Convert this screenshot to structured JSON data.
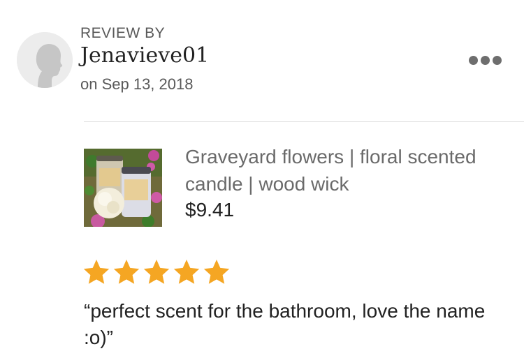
{
  "review": {
    "header_label": "REVIEW BY",
    "username": "Jenavieve01",
    "date": "on Sep 13, 2018",
    "more_icon": "ellipsis-icon"
  },
  "product": {
    "title": "Graveyard flowers | floral scented candle | wood wick",
    "price": "$9.41",
    "image_icon": "product-candle-image"
  },
  "rating": {
    "value": 5,
    "max": 5,
    "color": "#f5a623",
    "icon": "star-icon"
  },
  "review_text": "“perfect scent for the bathroom, love the name :o)”",
  "colors": {
    "text_primary": "#222222",
    "text_secondary": "#595959",
    "divider": "#dddddd"
  }
}
